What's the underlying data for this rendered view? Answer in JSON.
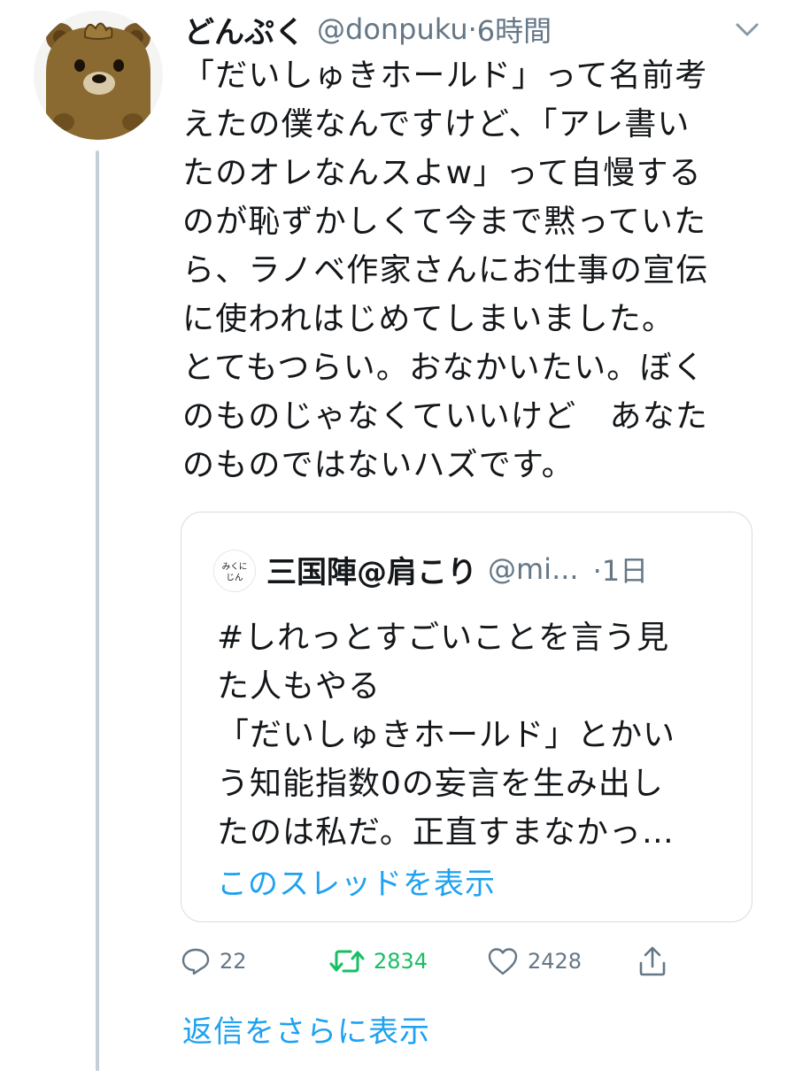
{
  "tweet": {
    "author": {
      "display_name": "どんぷく",
      "handle": "@donpuku",
      "avatar_icon": "bear-avatar-icon"
    },
    "separator": "·",
    "time": "6時間",
    "body": "「だいしゅきホールド」って名前考\nえたの僕なんですけど、「アレ書い\nたのオレなんスよw」って自慢する\nのが恥ずかしくて今まで黙っていた\nら、ラノベ作家さんにお仕事の宣伝\nに使われはじめてしまいました。\nとてもつらい。おなかいたい。ぼく\nのものじゃなくていいけど　あなた\nのものではないハズです。",
    "quoted": {
      "author": {
        "display_name": "三国陣@肩こり",
        "handle": "@mi...",
        "avatar_text_line1": "みくに",
        "avatar_text_line2": "じん"
      },
      "separator_time": "·1日",
      "body": "#しれっとすごいことを言う見\nた人もやる\n「だいしゅきホールド」とかい\nう知能指数0の妄言を生み出し\nたのは私だ。正直すまなかっ…",
      "show_thread_label": "このスレッドを表示"
    },
    "actions": {
      "reply_count": "22",
      "retweet_count": "2834",
      "like_count": "2428",
      "reply_icon": "reply-icon",
      "retweet_icon": "retweet-icon",
      "like_icon": "heart-icon",
      "share_icon": "share-icon"
    }
  },
  "show_more_replies_label": "返信をさらに表示",
  "colors": {
    "link": "#1da1f2",
    "retweet_active": "#17bf63",
    "secondary_text": "#657786",
    "thread_line": "#c4cfd6",
    "border": "#d5dde3"
  }
}
